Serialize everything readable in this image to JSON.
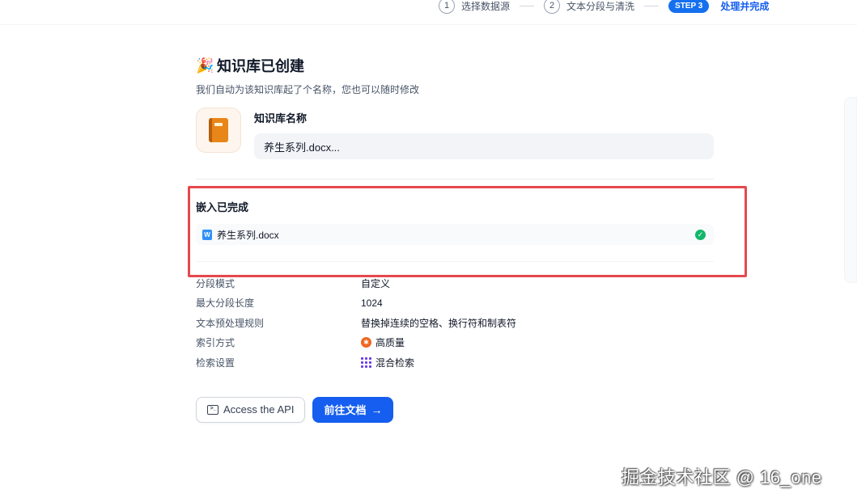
{
  "stepper": {
    "steps": [
      {
        "num": "1",
        "label": "选择数据源"
      },
      {
        "num": "2",
        "label": "文本分段与清洗"
      }
    ],
    "active_badge": "STEP 3",
    "active_label": "处理并完成"
  },
  "header": {
    "title": "知识库已创建",
    "subtitle": "我们自动为该知识库起了个名称，您也可以随时修改",
    "icon": "party-popper-icon"
  },
  "kb_name": {
    "label": "知识库名称",
    "value": "养生系列.docx..."
  },
  "embedding": {
    "title": "嵌入已完成",
    "file": {
      "name": "养生系列.docx",
      "status": "completed"
    }
  },
  "info": [
    {
      "key": "分段模式",
      "value": "自定义"
    },
    {
      "key": "最大分段长度",
      "value": "1024"
    },
    {
      "key": "文本预处理规则",
      "value": "替换掉连续的空格、换行符和制表符"
    },
    {
      "key": "索引方式",
      "value": "高质量"
    },
    {
      "key": "检索设置",
      "value": "混合检索"
    }
  ],
  "buttons": {
    "api": "Access the API",
    "go": "前往文档"
  },
  "watermark": "掘金技术社区 @ 16_one",
  "colors": {
    "accent": "#155eef",
    "highlight": "#e5484d",
    "success": "#12b76a"
  }
}
